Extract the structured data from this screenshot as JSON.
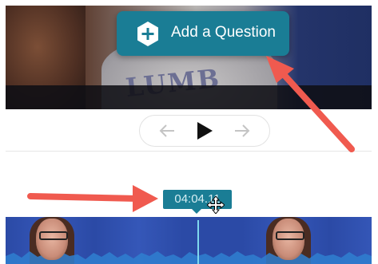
{
  "video": {
    "shirt_text": "LUMB"
  },
  "add_question": {
    "label": "Add a Question",
    "icon": "plus-hex-icon"
  },
  "nav": {
    "prev_icon": "arrow-left-icon",
    "play_icon": "play-icon",
    "next_icon": "arrow-right-icon"
  },
  "timeline": {
    "current_time": "04:04.11"
  },
  "colors": {
    "accent": "#1a7d95",
    "annotation_arrow": "#f05a4f",
    "playhead": "#7fd8ee"
  }
}
